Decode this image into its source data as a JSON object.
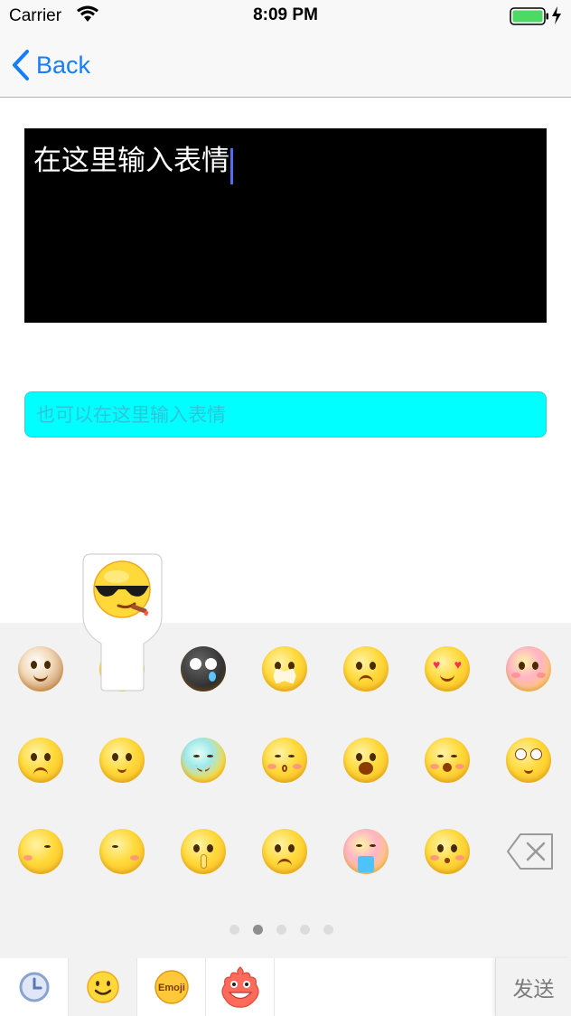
{
  "status_bar": {
    "carrier": "Carrier",
    "time": "8:09 PM",
    "icons": [
      "wifi-icon",
      "battery-icon",
      "charging-bolt-icon"
    ]
  },
  "nav_bar": {
    "back_label": "Back",
    "back_icon": "chevron-left-icon"
  },
  "text_view": {
    "value": "在这里输入表情"
  },
  "text_field": {
    "value": "",
    "placeholder": "也可以在这里输入表情"
  },
  "emoji_keyboard": {
    "selected_preview": "sunglasses-cigar-emoji",
    "rows": [
      [
        "cat-emoji",
        "sunglasses-cigar-emoji",
        "sweat-dark-emoji",
        "mouth-taped-emoji",
        "fist-angry-emoji",
        "heart-eyes-drool-emoji",
        "praying-blush-emoji"
      ],
      [
        "sad-tears-emoji",
        "thinking-emoji",
        "cold-sweat-emoji",
        "kissing-emoji",
        "yelling-emoji",
        "surprised-blush-emoji",
        "eyeroll-emoji"
      ],
      [
        "turn-left-emoji",
        "sly-emoji",
        "shush-emoji",
        "pleading-emoji",
        "vomit-emoji",
        "shy-emoji"
      ]
    ],
    "delete_icon": "backspace-icon",
    "page_count": 5,
    "current_page": 2
  },
  "toolbar": {
    "tabs": [
      "recent-clock-icon",
      "smiley-icon",
      "emoji-badge-icon",
      "monster-sticker-icon"
    ],
    "emoji_tab_label": "Emoji",
    "selected_tab": 1,
    "send_label": "发送"
  }
}
